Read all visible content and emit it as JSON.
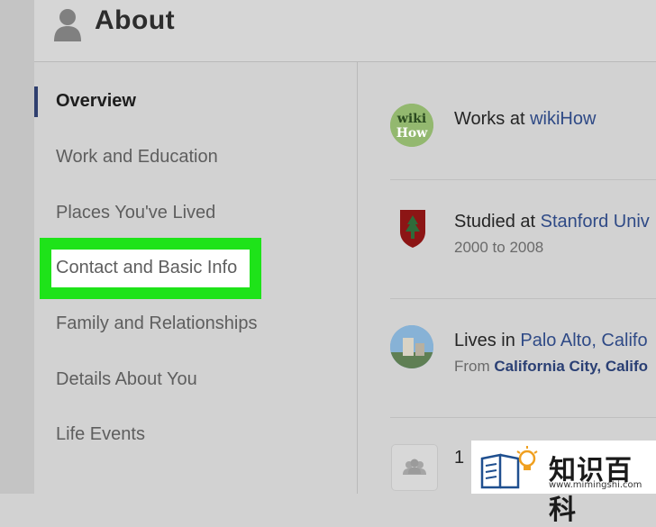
{
  "header": {
    "title": "About",
    "icon": "person-silhouette-icon"
  },
  "sidebar": {
    "items": [
      {
        "label": "Overview",
        "active": true
      },
      {
        "label": "Work and Education"
      },
      {
        "label": "Places You've Lived"
      },
      {
        "label": "Contact and Basic Info",
        "highlighted": true
      },
      {
        "label": "Family and Relationships"
      },
      {
        "label": "Details About You"
      },
      {
        "label": "Life Events"
      }
    ]
  },
  "overview": {
    "work": {
      "prefix": "Works at ",
      "org": "wikiHow",
      "logo_top": "wiki",
      "logo_bottom": "How"
    },
    "education": {
      "prefix": "Studied at ",
      "org": "Stanford Univ",
      "years": "2000 to 2008"
    },
    "lives": {
      "prefix": "Lives in ",
      "place": "Palo Alto, Califo",
      "from_label": "From ",
      "from_place": "California City, Califo"
    },
    "family_count": "1"
  },
  "watermark": {
    "title": "知识百科",
    "url": "www.mimingshi.com"
  },
  "colors": {
    "highlight": "#1ee319",
    "link": "#2f4a86",
    "active_bar": "#2f3f6e"
  }
}
